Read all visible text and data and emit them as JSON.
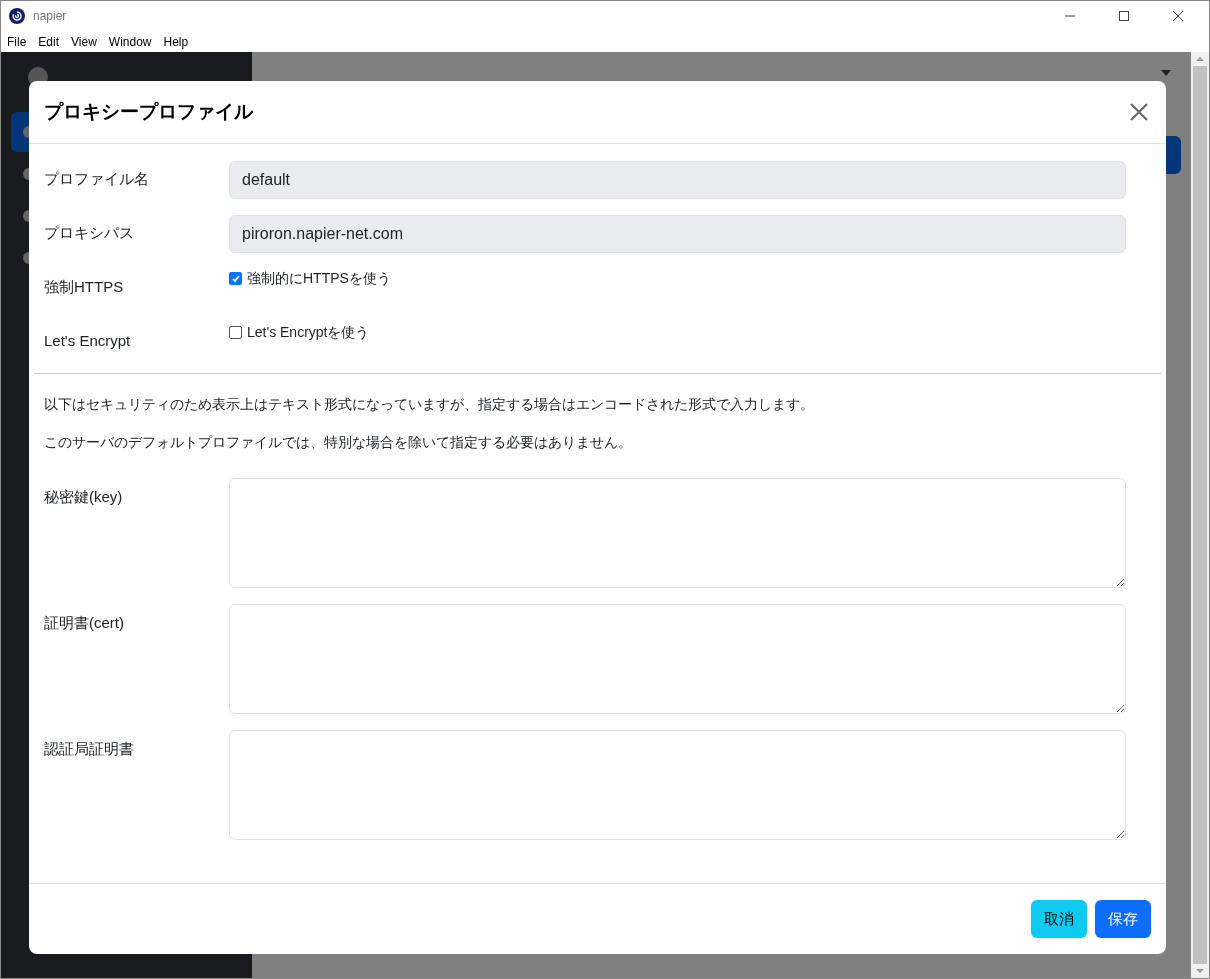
{
  "window": {
    "title": "napier"
  },
  "menu": [
    "File",
    "Edit",
    "View",
    "Window",
    "Help"
  ],
  "background": {
    "sidebar_items": [
      {
        "selected": true
      },
      {
        "selected": false
      },
      {
        "selected": false
      },
      {
        "selected": false
      }
    ]
  },
  "dialog": {
    "title": "プロキシープロファイル",
    "fields": [
      {
        "kind": "text",
        "label": "プロファイル名",
        "value": "default"
      },
      {
        "kind": "text",
        "label": "プロキシパス",
        "value": "piroron.napier-net.com"
      },
      {
        "kind": "checkbox",
        "label": "強制HTTPS",
        "text": "強制的にHTTPSを使う",
        "checked": true
      },
      {
        "kind": "checkbox",
        "label": "Let's Encrypt",
        "text": "Let's Encryptを使う",
        "checked": false
      }
    ],
    "notes": [
      "以下はセキュリティのため表示上はテキスト形式になっていますが、指定する場合はエンコードされた形式で入力します。",
      "このサーバのデフォルトプロファイルでは、特別な場合を除いて指定する必要はありません。"
    ],
    "textareas": [
      {
        "label": "秘密鍵(key)"
      },
      {
        "label": "証明書(cert)"
      },
      {
        "label": "認証局証明書"
      }
    ],
    "buttons": [
      {
        "label": "取消",
        "kind": "info"
      },
      {
        "label": "保存",
        "kind": "primary"
      }
    ]
  }
}
